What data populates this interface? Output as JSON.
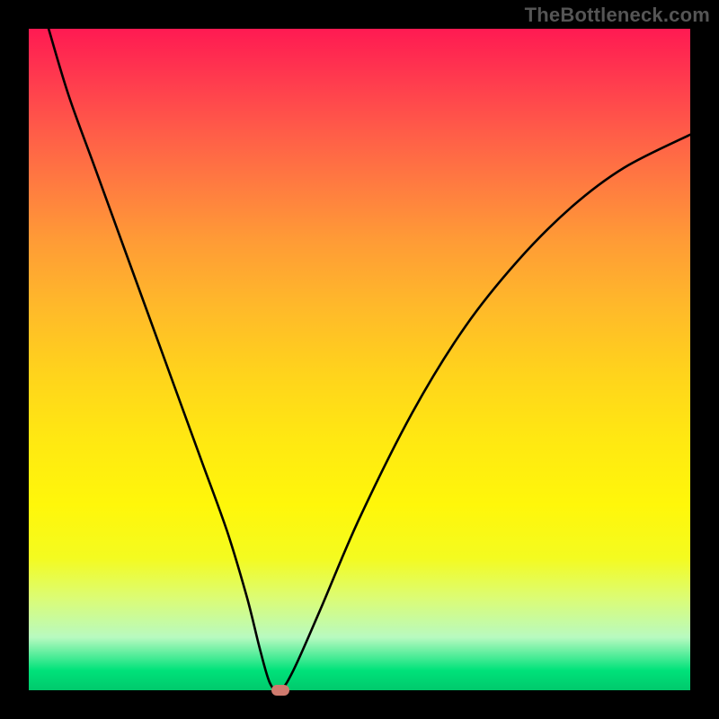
{
  "watermark": "TheBottleneck.com",
  "chart_data": {
    "type": "line",
    "title": "",
    "xlabel": "",
    "ylabel": "",
    "xlim": [
      0,
      100
    ],
    "ylim": [
      0,
      100
    ],
    "grid": false,
    "legend": false,
    "series": [
      {
        "name": "bottleneck-curve",
        "x": [
          3,
          6,
          10,
          14,
          18,
          22,
          26,
          30,
          33,
          35,
          36.5,
          38,
          40,
          44,
          50,
          58,
          66,
          74,
          82,
          90,
          100
        ],
        "values": [
          100,
          90,
          79,
          68,
          57,
          46,
          35,
          24,
          14,
          6,
          1,
          0,
          3,
          12,
          26,
          42,
          55,
          65,
          73,
          79,
          84
        ]
      }
    ],
    "marker": {
      "x": 38,
      "y": 0,
      "color": "#cf7a6e"
    },
    "background_gradient": {
      "top": "#ff1a52",
      "mid": "#ffe600",
      "bottom": "#00c96c"
    }
  }
}
